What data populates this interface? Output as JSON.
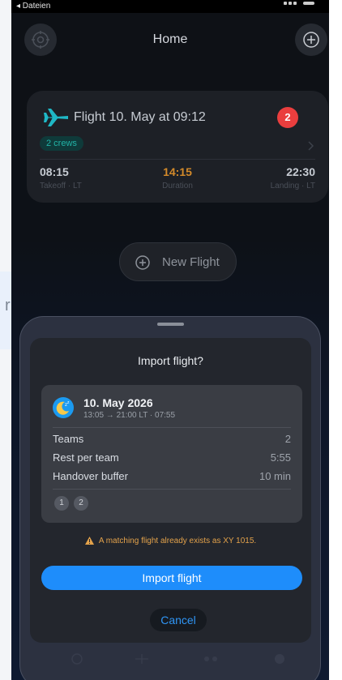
{
  "status_bar": {
    "back_label": "◂ Dateien"
  },
  "behind_page": {
    "partial_text": "r"
  },
  "header": {
    "title": "Home",
    "settings_icon": "gear-icon",
    "add_icon": "plus-circle-icon"
  },
  "flight_card": {
    "title": "Flight 10. May at 09:12",
    "badge_count": "2",
    "crews_label": "2 crews",
    "takeoff": {
      "time": "08:15",
      "label": "Takeoff · LT"
    },
    "duration": {
      "time": "14:15",
      "label": "Duration"
    },
    "landing": {
      "time": "22:30",
      "label": "Landing · LT"
    },
    "icon": "airplane-icon",
    "colors": {
      "plane": "#1fb8c6",
      "badge": "#ea3e3e",
      "duration": "#d38a2a"
    }
  },
  "new_flight": {
    "label": "New Flight",
    "icon": "plus-circle-icon"
  },
  "import_dialog": {
    "title": "Import flight?",
    "summary": {
      "date": "10. May 2026",
      "subtitle": "13:05 → 21:00 LT · 07:55",
      "icon": "sleeping-moon-icon",
      "rows": [
        {
          "label": "Teams",
          "value": "2"
        },
        {
          "label": "Rest per team",
          "value": "5:55"
        },
        {
          "label": "Handover buffer",
          "value": "10 min"
        }
      ],
      "crew_chips": [
        "1",
        "2"
      ]
    },
    "warning": "A matching flight already exists as XY 1015.",
    "import_label": "Import flight",
    "cancel_label": "Cancel",
    "colors": {
      "primary": "#1e8dfb",
      "warning": "#e3a24b"
    }
  }
}
